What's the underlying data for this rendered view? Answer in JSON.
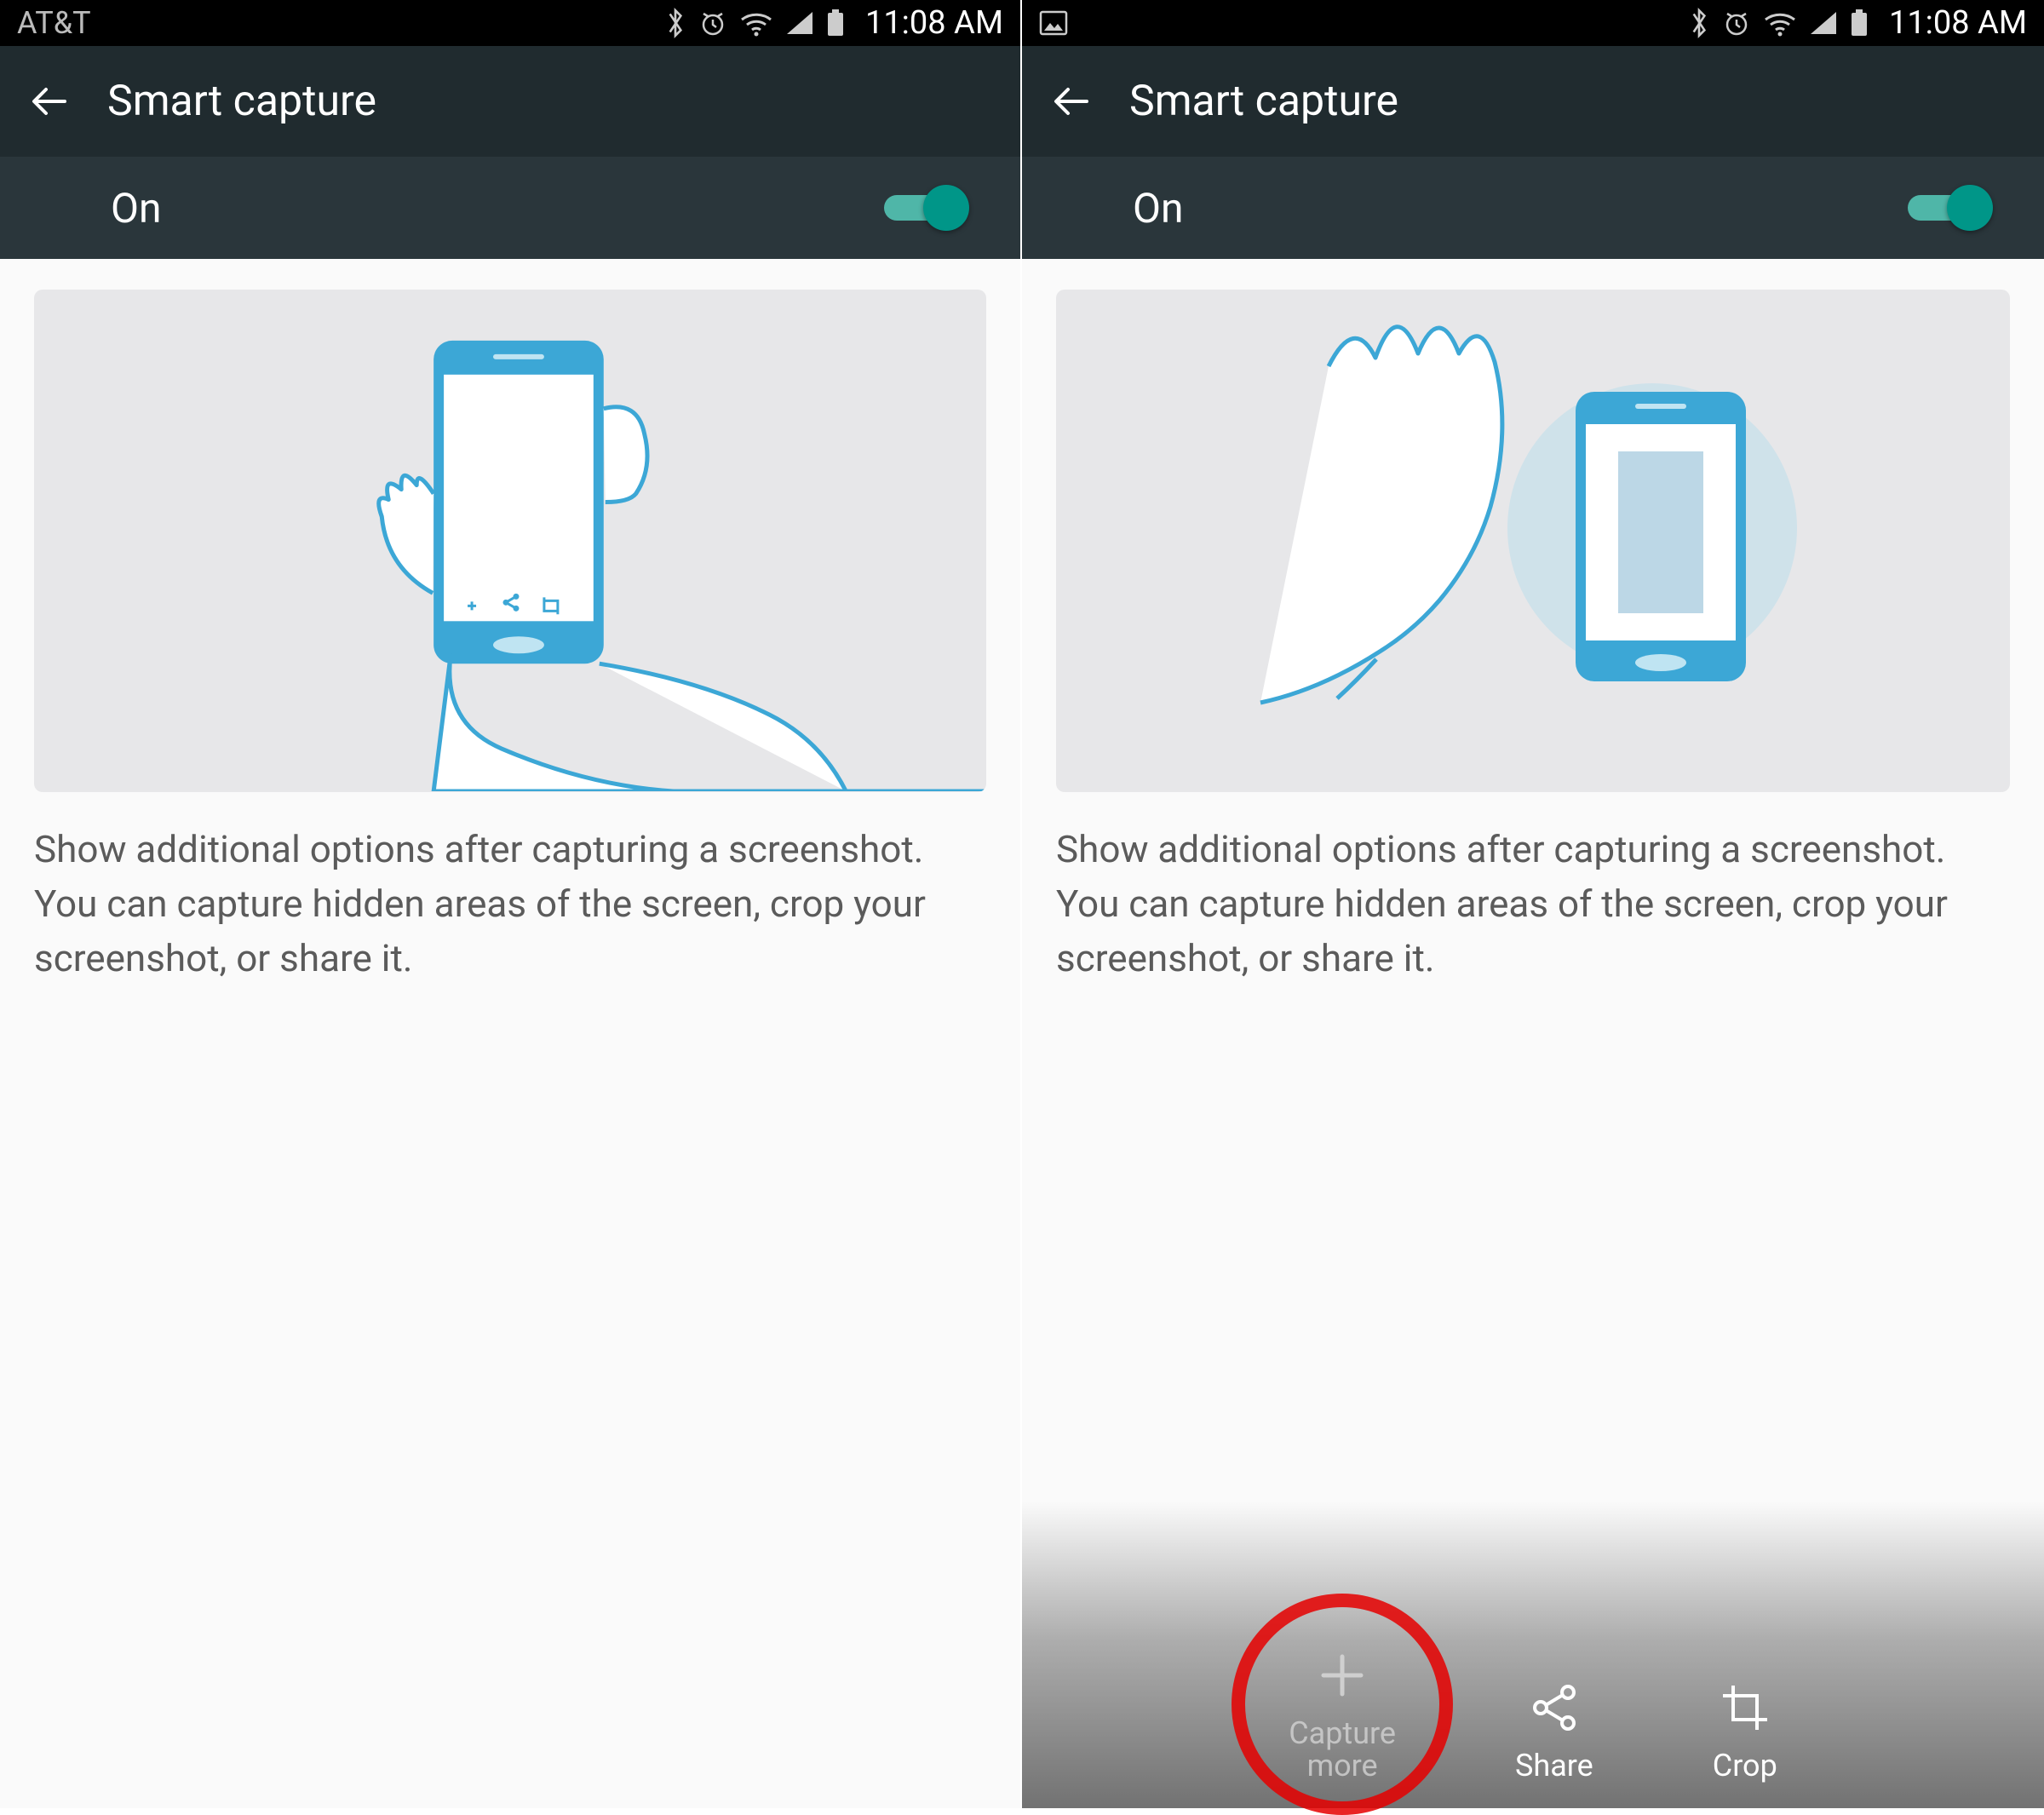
{
  "left": {
    "status": {
      "carrier": "AT&T",
      "time": "11:08 AM",
      "has_image_notif": false
    },
    "appbar": {
      "title": "Smart capture"
    },
    "toggle": {
      "label": "On",
      "on": true
    },
    "description": "Show additional options after capturing a screenshot. You can capture hidden areas of the screen, crop your screenshot, or share it."
  },
  "right": {
    "status": {
      "carrier": "",
      "time": "11:08 AM",
      "has_image_notif": true
    },
    "appbar": {
      "title": "Smart capture"
    },
    "toggle": {
      "label": "On",
      "on": true
    },
    "description": "Show additional options after capturing a screenshot. You can capture hidden areas of the screen, crop your screenshot, or share it.",
    "toolbar": {
      "capture_more": {
        "line1": "Capture",
        "line2": "more"
      },
      "share": "Share",
      "crop": "Crop"
    },
    "annotation": {
      "highlight": "capture-more"
    }
  },
  "icons": {
    "bluetooth": "bluetooth-icon",
    "alarm": "alarm-icon",
    "wifi": "wifi-icon",
    "signal": "signal-icon",
    "battery": "battery-icon",
    "image_notif": "image-notification-icon",
    "back": "arrow-left-icon",
    "plus": "plus-icon",
    "share": "share-icon",
    "crop": "crop-icon"
  },
  "colors": {
    "accent": "#009688",
    "appbar": "#202b2f",
    "toggle_row": "#2a363b",
    "illus_bg": "#e7e7e9",
    "phone_blue": "#3ca7d6"
  }
}
